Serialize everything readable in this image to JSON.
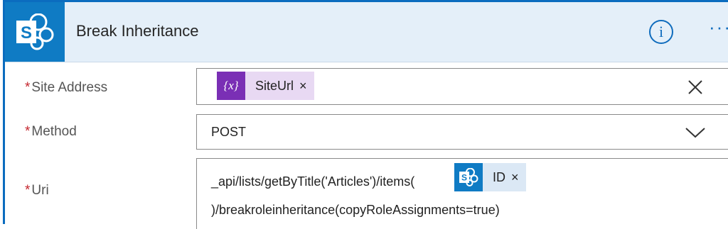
{
  "header": {
    "title": "Break Inheritance",
    "info_icon": "info-icon",
    "info_glyph": "i",
    "more_glyph": "···",
    "brand_color": "#0f7bc4"
  },
  "fields": {
    "site_address": {
      "label": "Site Address",
      "required_mark": "*",
      "token": {
        "label": "SiteUrl",
        "icon": "variable-icon",
        "close": "×",
        "color": "#e8d9f3"
      },
      "clear_icon": "clear-x-icon"
    },
    "method": {
      "label": "Method",
      "required_mark": "*",
      "value": "POST",
      "dropdown_icon": "chevron-down-icon"
    },
    "uri": {
      "label": "Uri",
      "required_mark": "*",
      "text_before": "_api/lists/getByTitle('Articles')/items(",
      "token": {
        "label": "ID",
        "icon": "sharepoint-icon",
        "close": "×",
        "color": "#dbe8f5"
      },
      "text_after": ")/breakroleinheritance(copyRoleAssignments=true)"
    }
  }
}
